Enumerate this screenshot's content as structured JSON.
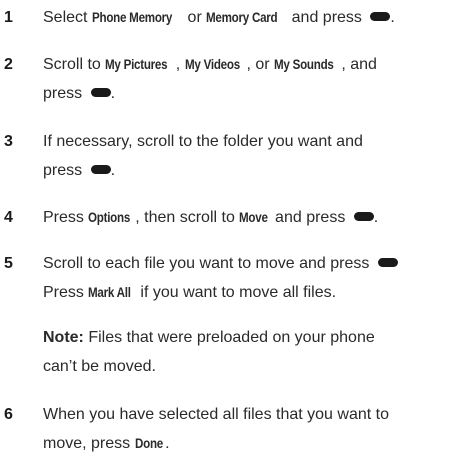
{
  "icons": {
    "select_key": "center-select-key-icon"
  },
  "steps": [
    {
      "number": "1",
      "t1": "Select ",
      "b1": "Phone Memory",
      "t2": " or ",
      "b2": "Memory Card",
      "t3": " and press "
    },
    {
      "number": "2",
      "t1": "Scroll to ",
      "b1": "My Pictures",
      "t2": ", ",
      "b2": "My Videos",
      "t3": ", or ",
      "b3": "My Sounds",
      "t4": ", and",
      "l2": "press "
    },
    {
      "number": "3",
      "l1": "If necessary, scroll to the folder you want and",
      "l2": "press "
    },
    {
      "number": "4",
      "t1": "Press ",
      "b1": "Options",
      "t2": ", then scroll to ",
      "b2": "Move",
      "t3": " and press "
    },
    {
      "number": "5",
      "l1": "Scroll to each file you want to move and press ",
      "l2a": "Press ",
      "l2b": "Mark All",
      "l2c": " if you want to move all files.",
      "note_label": "Note:",
      "note_l1": " Files that were preloaded on your phone",
      "note_l2": "can’t be moved."
    },
    {
      "number": "6",
      "l1": "When you have selected all files that you want to",
      "l2a": "move, press ",
      "l2b": "Done",
      "l2c": "."
    }
  ]
}
